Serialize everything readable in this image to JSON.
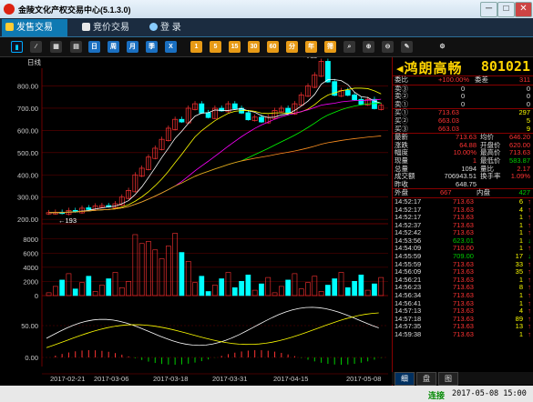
{
  "window": {
    "title": "金陵文化产权交易中心(5.1.3.0)",
    "min": "─",
    "max": "□",
    "close": "✕"
  },
  "tabs": [
    {
      "label": "发售交易",
      "active": true
    },
    {
      "label": "竞价交易",
      "active": false
    },
    {
      "label": "登 录",
      "active": false
    }
  ],
  "toolbar": {
    "buttons": [
      "日",
      "周",
      "月",
      "季",
      "X",
      "1",
      "5",
      "15",
      "30",
      "60",
      "分",
      "年",
      "筛"
    ]
  },
  "chart": {
    "period_label": "日线",
    "ylabels": [
      "800.00",
      "700.00",
      "600.00",
      "500.00",
      "400.00",
      "300.00",
      "200.00"
    ],
    "vol_labels": [
      "8000",
      "6000",
      "4000",
      "2000",
      "0"
    ],
    "ind_labels": [
      "50.00",
      "0.00"
    ],
    "high_marker": "911",
    "low_marker": "193",
    "dates": [
      "2017-02-21",
      "2017-03-06",
      "2017-03-18",
      "2017-03-31",
      "2017-04-15",
      "2017-05-08"
    ]
  },
  "chart_data": {
    "type": "candlestick",
    "series": [
      {
        "name": "K",
        "values": [
          230,
          232,
          228,
          240,
          235,
          250,
          248,
          260,
          262,
          258,
          270,
          300,
          330,
          400,
          430,
          480,
          520,
          560,
          610,
          650,
          640,
          700,
          720,
          680,
          660,
          700,
          690,
          720,
          700,
          680,
          650,
          660,
          640,
          660,
          690,
          700,
          680,
          720,
          760,
          800,
          850,
          911,
          820,
          760,
          780,
          760,
          740,
          720,
          740,
          700,
          713
        ]
      }
    ]
  },
  "panel": {
    "name": "鸿朗高畅",
    "code": "801021",
    "wb": {
      "label": "委比",
      "value": "+100.00%",
      "label2": "委差",
      "value2": "311"
    },
    "sell": [
      {
        "l": "卖③",
        "p": "0",
        "v": "0"
      },
      {
        "l": "卖②",
        "p": "0",
        "v": "0"
      },
      {
        "l": "卖①",
        "p": "0",
        "v": "0"
      }
    ],
    "buy": [
      {
        "l": "买①",
        "p": "713.63",
        "v": "297"
      },
      {
        "l": "买②",
        "p": "663.03",
        "v": "5"
      },
      {
        "l": "买③",
        "p": "663.03",
        "v": "9"
      }
    ],
    "stats": [
      {
        "l1": "最新",
        "v1": "713.63",
        "l2": "均价",
        "v2": "646.20"
      },
      {
        "l1": "涨跌",
        "v1": "64.88",
        "l2": "开盘价",
        "v2": "620.00"
      },
      {
        "l1": "幅度",
        "v1": "10.00%",
        "l2": "最高价",
        "v2": "713.63"
      },
      {
        "l1": "现量",
        "v1": "1",
        "l2": "最低价",
        "v2": "583.87"
      },
      {
        "l1": "总量",
        "v1": "1094",
        "l2": "量比",
        "v2": "2.17"
      },
      {
        "l1": "成交额",
        "v1": "706943.51",
        "l2": "换手率",
        "v2": "1.09%"
      },
      {
        "l1": "昨收",
        "v1": "648.75",
        "l2": "",
        "v2": ""
      }
    ],
    "wai": {
      "l": "外盘",
      "v": "667",
      "l2": "内盘",
      "v2": "427"
    },
    "ticks": [
      {
        "t": "14:52:17",
        "p": "713.63",
        "v": "6",
        "d": "↑"
      },
      {
        "t": "14:52:17",
        "p": "713.63",
        "v": "4",
        "d": "↑"
      },
      {
        "t": "14:52:17",
        "p": "713.63",
        "v": "1",
        "d": "↑"
      },
      {
        "t": "14:52:37",
        "p": "713.63",
        "v": "1",
        "d": "↑"
      },
      {
        "t": "14:52:42",
        "p": "713.63",
        "v": "1",
        "d": "↑"
      },
      {
        "t": "14:53:56",
        "p": "623.01",
        "v": "1",
        "d": "↓"
      },
      {
        "t": "14:54:09",
        "p": "710.00",
        "v": "1",
        "d": "↑"
      },
      {
        "t": "14:55:59",
        "p": "709.00",
        "v": "17",
        "d": "↓"
      },
      {
        "t": "14:55:59",
        "p": "713.63",
        "v": "33",
        "d": "↑"
      },
      {
        "t": "14:56:09",
        "p": "713.63",
        "v": "35",
        "d": "↑"
      },
      {
        "t": "14:56:21",
        "p": "713.63",
        "v": "1",
        "d": "↑"
      },
      {
        "t": "14:56:23",
        "p": "713.63",
        "v": "8",
        "d": "↑"
      },
      {
        "t": "14:56:34",
        "p": "713.63",
        "v": "1",
        "d": "↑"
      },
      {
        "t": "14:56:41",
        "p": "713.63",
        "v": "1",
        "d": "↑"
      },
      {
        "t": "14:57:13",
        "p": "713.63",
        "v": "4",
        "d": "↑"
      },
      {
        "t": "14:57:18",
        "p": "713.63",
        "v": "89",
        "d": "↑"
      },
      {
        "t": "14:57:35",
        "p": "713.63",
        "v": "13",
        "d": "↑"
      },
      {
        "t": "14:59:38",
        "p": "713.63",
        "v": "1",
        "d": "↑"
      }
    ]
  },
  "bottom_tabs": [
    "细",
    "盘",
    "图"
  ],
  "status": {
    "conn": "连接",
    "time": "2017-05-08 15:00"
  }
}
